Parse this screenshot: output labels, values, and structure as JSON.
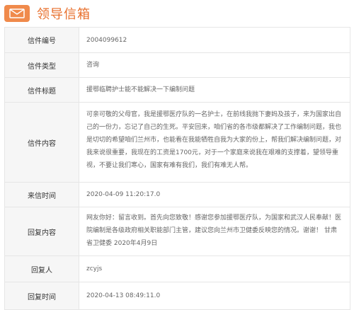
{
  "header": {
    "title": "领导信箱",
    "icon": "mail-icon"
  },
  "fields": [
    {
      "label": "信件编号",
      "value": "2004099612"
    },
    {
      "label": "信件类型",
      "value": "咨询"
    },
    {
      "label": "信件标题",
      "value": "援鄂临聘护士能不能解决一下编制问题"
    },
    {
      "label": "信件内容",
      "value": "可亲可敬的父母官，我是援鄂医疗队的一名护士，在前线我抛下妻妈及孩子，来为国家出自己的一份力，忘记了自己的生死。平安回来，咱们省的各市级都解决了工作编制问题，我也是切切的希望咱们兰州市，也能看在我能牺牲自我为大家的份上，帮我们解决编制问题，对我来说很重要，我现在的工资是1700元，对于一个家庭来说我在艰难的支撑着，望领导重视，不要让我们寒心，国家有难有我们，我们有难无人帮。"
    },
    {
      "label": "来信时间",
      "value": "2020-04-09 11:20:17.0"
    },
    {
      "label": "回复内容",
      "value": "网友你好：留言收到。首先向您致敬！感谢您参加援鄂医疗队，为国家和武汉人民奉献！医院编制是各级政府相关职能部门主管，建议您向兰州市卫健委反映您的情况。谢谢！ 甘肃省卫健委 2020年4月9日"
    },
    {
      "label": "回复人",
      "value": "zcyjs"
    },
    {
      "label": "回复时间",
      "value": "2020-04-13 08:49:11.0"
    }
  ],
  "colors": {
    "accent": "#e86f2c",
    "icon_bg": "#f08a4b",
    "label_bg": "#f6f6f6",
    "border": "#e6e6e6"
  }
}
